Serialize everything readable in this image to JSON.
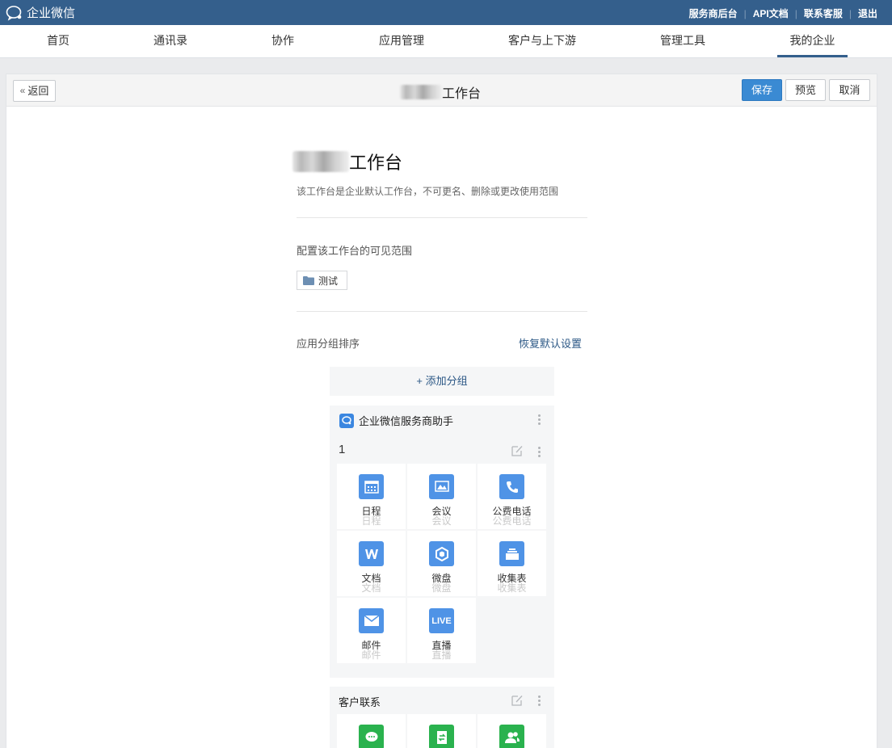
{
  "topbar": {
    "logo_text": "企业微信",
    "links": [
      "服务商后台",
      "API文档",
      "联系客服",
      "退出"
    ]
  },
  "nav": {
    "items": [
      "首页",
      "通讯录",
      "协作",
      "应用管理",
      "客户与上下游",
      "管理工具",
      "我的企业"
    ],
    "active": "我的企业"
  },
  "panel_header": {
    "back_label": "返回",
    "title_suffix": "工作台",
    "save_label": "保存",
    "preview_label": "预览",
    "cancel_label": "取消"
  },
  "workbench": {
    "title_suffix": "工作台",
    "description": "该工作台是企业默认工作台，不可更名、删除或更改使用范围",
    "visibility_label": "配置该工作台的可见范围",
    "scope_tag": "测试",
    "sort_label": "应用分组排序",
    "reset_link": "恢复默认设置",
    "add_group_label": "+ 添加分组"
  },
  "groups": [
    {
      "title": "企业微信服务商助手",
      "subgroup_label": "1",
      "apps": [
        {
          "name": "日程",
          "icon": "calendar-icon",
          "color": "#4f93e6"
        },
        {
          "name": "会议",
          "icon": "meeting-icon",
          "color": "#4f93e6"
        },
        {
          "name": "公费电话",
          "icon": "phone-icon",
          "color": "#4f93e6"
        },
        {
          "name": "文档",
          "icon": "document-icon",
          "color": "#4f93e6"
        },
        {
          "name": "微盘",
          "icon": "drive-icon",
          "color": "#4f93e6"
        },
        {
          "name": "收集表",
          "icon": "form-icon",
          "color": "#4f93e6"
        },
        {
          "name": "邮件",
          "icon": "mail-icon",
          "color": "#4f93e6"
        },
        {
          "name": "直播",
          "icon": "live-icon",
          "color": "#4f93e6",
          "icon_text": "LIVE"
        }
      ]
    },
    {
      "title": "客户联系",
      "apps": [
        {
          "name": "",
          "icon": "chat-icon",
          "color": "#2ab24e"
        },
        {
          "name": "",
          "icon": "transfer-icon",
          "color": "#2ab24e"
        },
        {
          "name": "",
          "icon": "customer-group-icon",
          "color": "#2ab24e"
        }
      ]
    }
  ]
}
